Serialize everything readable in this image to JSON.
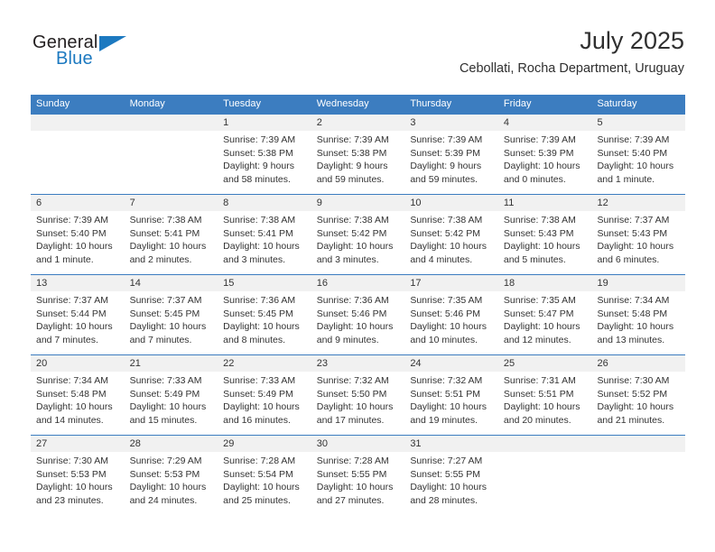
{
  "brand": {
    "word_one": "General",
    "word_two": "Blue",
    "logo_icon": "triangle-logo-icon",
    "accent_color": "#1c79c0"
  },
  "header": {
    "month_title": "July 2025",
    "location": "Cebollati, Rocha Department, Uruguay"
  },
  "calendar": {
    "header_color": "#3c7dc0",
    "day_band_color": "#f1f1f1",
    "weekday_headers": [
      "Sunday",
      "Monday",
      "Tuesday",
      "Wednesday",
      "Thursday",
      "Friday",
      "Saturday"
    ],
    "weeks": [
      [
        {
          "day": "",
          "sunrise": "",
          "sunset": "",
          "daylight_line1": "",
          "daylight_line2": ""
        },
        {
          "day": "",
          "sunrise": "",
          "sunset": "",
          "daylight_line1": "",
          "daylight_line2": ""
        },
        {
          "day": "1",
          "sunrise": "Sunrise: 7:39 AM",
          "sunset": "Sunset: 5:38 PM",
          "daylight_line1": "Daylight: 9 hours",
          "daylight_line2": "and 58 minutes."
        },
        {
          "day": "2",
          "sunrise": "Sunrise: 7:39 AM",
          "sunset": "Sunset: 5:38 PM",
          "daylight_line1": "Daylight: 9 hours",
          "daylight_line2": "and 59 minutes."
        },
        {
          "day": "3",
          "sunrise": "Sunrise: 7:39 AM",
          "sunset": "Sunset: 5:39 PM",
          "daylight_line1": "Daylight: 9 hours",
          "daylight_line2": "and 59 minutes."
        },
        {
          "day": "4",
          "sunrise": "Sunrise: 7:39 AM",
          "sunset": "Sunset: 5:39 PM",
          "daylight_line1": "Daylight: 10 hours",
          "daylight_line2": "and 0 minutes."
        },
        {
          "day": "5",
          "sunrise": "Sunrise: 7:39 AM",
          "sunset": "Sunset: 5:40 PM",
          "daylight_line1": "Daylight: 10 hours",
          "daylight_line2": "and 1 minute."
        }
      ],
      [
        {
          "day": "6",
          "sunrise": "Sunrise: 7:39 AM",
          "sunset": "Sunset: 5:40 PM",
          "daylight_line1": "Daylight: 10 hours",
          "daylight_line2": "and 1 minute."
        },
        {
          "day": "7",
          "sunrise": "Sunrise: 7:38 AM",
          "sunset": "Sunset: 5:41 PM",
          "daylight_line1": "Daylight: 10 hours",
          "daylight_line2": "and 2 minutes."
        },
        {
          "day": "8",
          "sunrise": "Sunrise: 7:38 AM",
          "sunset": "Sunset: 5:41 PM",
          "daylight_line1": "Daylight: 10 hours",
          "daylight_line2": "and 3 minutes."
        },
        {
          "day": "9",
          "sunrise": "Sunrise: 7:38 AM",
          "sunset": "Sunset: 5:42 PM",
          "daylight_line1": "Daylight: 10 hours",
          "daylight_line2": "and 3 minutes."
        },
        {
          "day": "10",
          "sunrise": "Sunrise: 7:38 AM",
          "sunset": "Sunset: 5:42 PM",
          "daylight_line1": "Daylight: 10 hours",
          "daylight_line2": "and 4 minutes."
        },
        {
          "day": "11",
          "sunrise": "Sunrise: 7:38 AM",
          "sunset": "Sunset: 5:43 PM",
          "daylight_line1": "Daylight: 10 hours",
          "daylight_line2": "and 5 minutes."
        },
        {
          "day": "12",
          "sunrise": "Sunrise: 7:37 AM",
          "sunset": "Sunset: 5:43 PM",
          "daylight_line1": "Daylight: 10 hours",
          "daylight_line2": "and 6 minutes."
        }
      ],
      [
        {
          "day": "13",
          "sunrise": "Sunrise: 7:37 AM",
          "sunset": "Sunset: 5:44 PM",
          "daylight_line1": "Daylight: 10 hours",
          "daylight_line2": "and 7 minutes."
        },
        {
          "day": "14",
          "sunrise": "Sunrise: 7:37 AM",
          "sunset": "Sunset: 5:45 PM",
          "daylight_line1": "Daylight: 10 hours",
          "daylight_line2": "and 7 minutes."
        },
        {
          "day": "15",
          "sunrise": "Sunrise: 7:36 AM",
          "sunset": "Sunset: 5:45 PM",
          "daylight_line1": "Daylight: 10 hours",
          "daylight_line2": "and 8 minutes."
        },
        {
          "day": "16",
          "sunrise": "Sunrise: 7:36 AM",
          "sunset": "Sunset: 5:46 PM",
          "daylight_line1": "Daylight: 10 hours",
          "daylight_line2": "and 9 minutes."
        },
        {
          "day": "17",
          "sunrise": "Sunrise: 7:35 AM",
          "sunset": "Sunset: 5:46 PM",
          "daylight_line1": "Daylight: 10 hours",
          "daylight_line2": "and 10 minutes."
        },
        {
          "day": "18",
          "sunrise": "Sunrise: 7:35 AM",
          "sunset": "Sunset: 5:47 PM",
          "daylight_line1": "Daylight: 10 hours",
          "daylight_line2": "and 12 minutes."
        },
        {
          "day": "19",
          "sunrise": "Sunrise: 7:34 AM",
          "sunset": "Sunset: 5:48 PM",
          "daylight_line1": "Daylight: 10 hours",
          "daylight_line2": "and 13 minutes."
        }
      ],
      [
        {
          "day": "20",
          "sunrise": "Sunrise: 7:34 AM",
          "sunset": "Sunset: 5:48 PM",
          "daylight_line1": "Daylight: 10 hours",
          "daylight_line2": "and 14 minutes."
        },
        {
          "day": "21",
          "sunrise": "Sunrise: 7:33 AM",
          "sunset": "Sunset: 5:49 PM",
          "daylight_line1": "Daylight: 10 hours",
          "daylight_line2": "and 15 minutes."
        },
        {
          "day": "22",
          "sunrise": "Sunrise: 7:33 AM",
          "sunset": "Sunset: 5:49 PM",
          "daylight_line1": "Daylight: 10 hours",
          "daylight_line2": "and 16 minutes."
        },
        {
          "day": "23",
          "sunrise": "Sunrise: 7:32 AM",
          "sunset": "Sunset: 5:50 PM",
          "daylight_line1": "Daylight: 10 hours",
          "daylight_line2": "and 17 minutes."
        },
        {
          "day": "24",
          "sunrise": "Sunrise: 7:32 AM",
          "sunset": "Sunset: 5:51 PM",
          "daylight_line1": "Daylight: 10 hours",
          "daylight_line2": "and 19 minutes."
        },
        {
          "day": "25",
          "sunrise": "Sunrise: 7:31 AM",
          "sunset": "Sunset: 5:51 PM",
          "daylight_line1": "Daylight: 10 hours",
          "daylight_line2": "and 20 minutes."
        },
        {
          "day": "26",
          "sunrise": "Sunrise: 7:30 AM",
          "sunset": "Sunset: 5:52 PM",
          "daylight_line1": "Daylight: 10 hours",
          "daylight_line2": "and 21 minutes."
        }
      ],
      [
        {
          "day": "27",
          "sunrise": "Sunrise: 7:30 AM",
          "sunset": "Sunset: 5:53 PM",
          "daylight_line1": "Daylight: 10 hours",
          "daylight_line2": "and 23 minutes."
        },
        {
          "day": "28",
          "sunrise": "Sunrise: 7:29 AM",
          "sunset": "Sunset: 5:53 PM",
          "daylight_line1": "Daylight: 10 hours",
          "daylight_line2": "and 24 minutes."
        },
        {
          "day": "29",
          "sunrise": "Sunrise: 7:28 AM",
          "sunset": "Sunset: 5:54 PM",
          "daylight_line1": "Daylight: 10 hours",
          "daylight_line2": "and 25 minutes."
        },
        {
          "day": "30",
          "sunrise": "Sunrise: 7:28 AM",
          "sunset": "Sunset: 5:55 PM",
          "daylight_line1": "Daylight: 10 hours",
          "daylight_line2": "and 27 minutes."
        },
        {
          "day": "31",
          "sunrise": "Sunrise: 7:27 AM",
          "sunset": "Sunset: 5:55 PM",
          "daylight_line1": "Daylight: 10 hours",
          "daylight_line2": "and 28 minutes."
        },
        {
          "day": "",
          "sunrise": "",
          "sunset": "",
          "daylight_line1": "",
          "daylight_line2": ""
        },
        {
          "day": "",
          "sunrise": "",
          "sunset": "",
          "daylight_line1": "",
          "daylight_line2": ""
        }
      ]
    ]
  }
}
